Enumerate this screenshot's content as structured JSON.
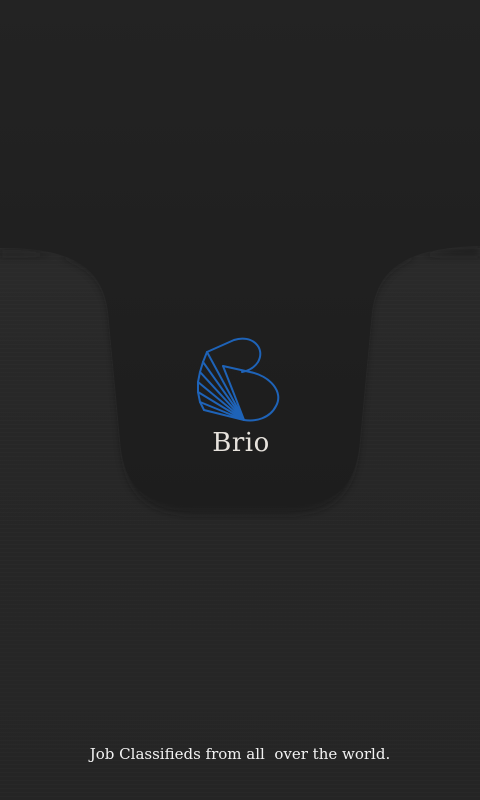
{
  "splash": {
    "brand_name": "Brio",
    "tagline": "Job Classifieds from all  over the world.",
    "logo_icon": "brio-book-logo-icon"
  },
  "colors": {
    "background": "#262626",
    "panel": "#1f1f1f",
    "logo_blue": "#1e63b8",
    "brand_text": "#e6e2dc",
    "tagline_text": "#f2f2f2"
  }
}
